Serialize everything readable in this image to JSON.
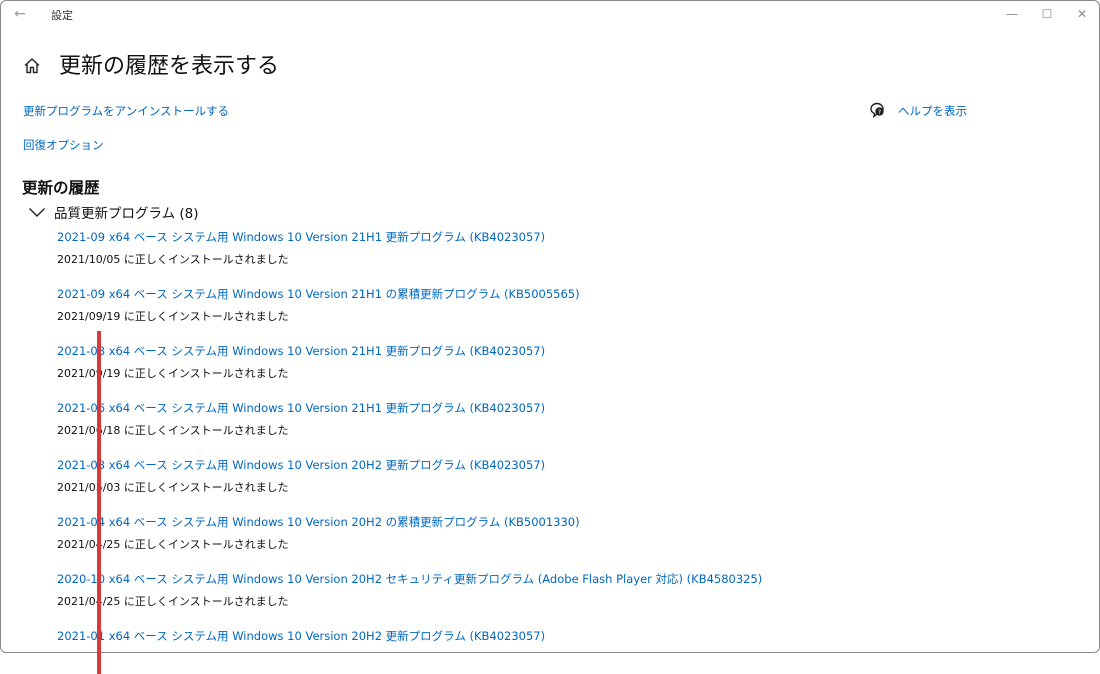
{
  "window": {
    "title": "設定",
    "back_icon": "←",
    "minimize_icon": "—",
    "maximize_icon": "☐",
    "close_icon": "✕"
  },
  "header": {
    "title": "更新の履歴を表示する"
  },
  "links": {
    "uninstall": "更新プログラムをアンインストールする",
    "recovery": "回復オプション",
    "help": "ヘルプを表示"
  },
  "section": {
    "title": "更新の履歴",
    "group_label": "品質更新プログラム (8)"
  },
  "updates": [
    {
      "name": "2021-09 x64 ベース システム用 Windows 10 Version 21H1 更新プログラム (KB4023057)",
      "status": "2021/10/05 に正しくインストールされました"
    },
    {
      "name": "2021-09 x64 ベース システム用 Windows 10 Version 21H1 の累積更新プログラム (KB5005565)",
      "status": "2021/09/19 に正しくインストールされました"
    },
    {
      "name": "2021-08 x64 ベース システム用 Windows 10 Version 21H1 更新プログラム (KB4023057)",
      "status": "2021/09/19 に正しくインストールされました"
    },
    {
      "name": "2021-06 x64 ベース システム用 Windows 10 Version 21H1 更新プログラム (KB4023057)",
      "status": "2021/06/18 に正しくインストールされました"
    },
    {
      "name": "2021-03 x64 ベース システム用 Windows 10 Version 20H2 更新プログラム (KB4023057)",
      "status": "2021/05/03 に正しくインストールされました"
    },
    {
      "name": "2021-04 x64 ベース システム用 Windows 10 Version 20H2 の累積更新プログラム (KB5001330)",
      "status": "2021/04/25 に正しくインストールされました"
    },
    {
      "name": "2020-10 x64 ベース システム用 Windows 10 Version 20H2 セキュリティ更新プログラム (Adobe Flash Player 対応) (KB4580325)",
      "status": "2021/04/25 に正しくインストールされました"
    },
    {
      "name": "2021-01 x64 ベース システム用 Windows 10 Version 20H2 更新プログラム (KB4023057)",
      "status": ""
    }
  ],
  "colors": {
    "link": "#0067c0",
    "marker": "#d63a3a"
  }
}
